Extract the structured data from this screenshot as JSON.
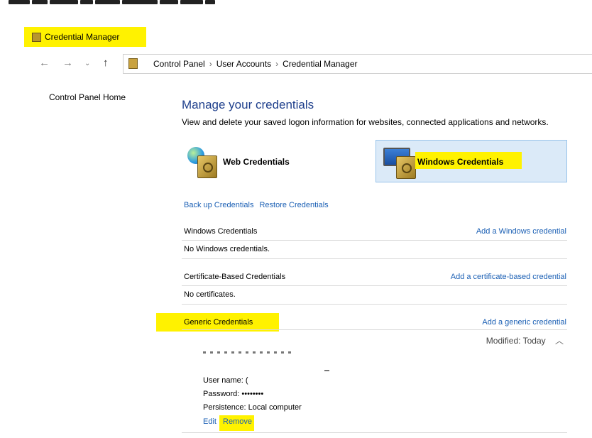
{
  "window": {
    "title": "Credential Manager"
  },
  "nav": {
    "back_icon": "arrow-left-icon",
    "forward_icon": "arrow-right-icon",
    "recent_icon": "chevron-down-icon",
    "up_icon": "arrow-up-icon"
  },
  "breadcrumb": [
    "Control Panel",
    "User Accounts",
    "Credential Manager"
  ],
  "sidebar": {
    "home_link": "Control Panel Home"
  },
  "main": {
    "title": "Manage your credentials",
    "description": "View and delete your saved logon information for websites, connected applications and networks.",
    "tiles": [
      {
        "label": "Web Credentials",
        "selected": false
      },
      {
        "label": "Windows Credentials",
        "selected": true
      }
    ],
    "backup_link": "Back up Credentials",
    "restore_link": "Restore Credentials"
  },
  "sections": {
    "windows": {
      "title": "Windows Credentials",
      "add": "Add a Windows credential",
      "empty": "No Windows credentials."
    },
    "certificate": {
      "title": "Certificate-Based Credentials",
      "add": "Add a certificate-based credential",
      "empty": "No certificates."
    },
    "generic": {
      "title": "Generic Credentials",
      "add": "Add a generic credential"
    }
  },
  "entry": {
    "modified_label": "Modified:",
    "modified_value": "Today",
    "username_label": "User name:",
    "username_value": "(",
    "password_label": "Password:",
    "password_value": "••••••••",
    "persistence_label": "Persistence:",
    "persistence_value": "Local computer",
    "edit": "Edit",
    "remove": "Remove"
  },
  "colors": {
    "highlight": "#fff200",
    "link": "#1a5fb4",
    "selected_tile": "#dbeaf8"
  }
}
